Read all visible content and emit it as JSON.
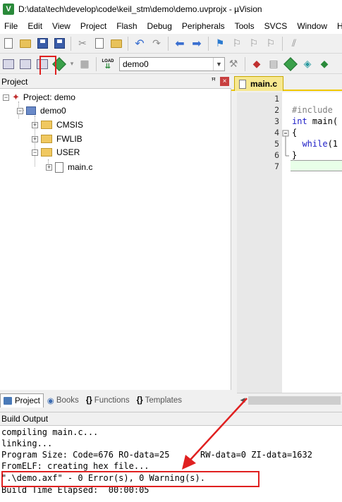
{
  "window": {
    "title": "D:\\data\\tech\\develop\\code\\keil_stm\\demo\\demo.uvprojx - µVision",
    "app_icon": "V"
  },
  "menu": [
    "File",
    "Edit",
    "View",
    "Project",
    "Flash",
    "Debug",
    "Peripherals",
    "Tools",
    "SVCS",
    "Window",
    "He"
  ],
  "toolbar2": {
    "target": "demo0",
    "load_icon_text": "LOAD"
  },
  "project_panel": {
    "title": "Project",
    "pin": "ꟸ",
    "close": "×",
    "tree": {
      "root": "Project: demo",
      "target": "demo0",
      "groups": [
        "CMSIS",
        "FWLIB",
        "USER"
      ],
      "file": "main.c"
    },
    "tabs": [
      {
        "label": "Project",
        "icon": "project-icon"
      },
      {
        "label": "Books",
        "icon": "books-icon"
      },
      {
        "label": "Functions",
        "icon": "functions-icon",
        "glyph": "{}"
      },
      {
        "label": "Templates",
        "icon": "templates-icon",
        "glyph": "{}"
      }
    ]
  },
  "editor": {
    "tab": "main.c",
    "line_numbers": [
      "1",
      "2",
      "3",
      "4",
      "5",
      "6",
      "7"
    ],
    "code": {
      "include_kw": "#include",
      "int_kw": "int",
      "main_text": "main(",
      "brace_open": "{",
      "while_kw": "while",
      "while_rest": "(1",
      "brace_close": "}"
    }
  },
  "build_output": {
    "title": "Build Output",
    "lines": [
      "compiling main.c...",
      "linking...",
      "Program Size: Code=676 RO-data=25",
      "FromELF: creating hex file...",
      "\".\\demo.axf\" - 0 Error(s), 0 Warning(s).",
      "Build Time Elapsed:  00:00:05"
    ],
    "size_rest": "RW-data=0 ZI-data=1632"
  },
  "colors": {
    "annotation": "#e02020",
    "keyword": "#2020c8",
    "preprocessor": "#808080",
    "active_tab": "#f7e890"
  }
}
